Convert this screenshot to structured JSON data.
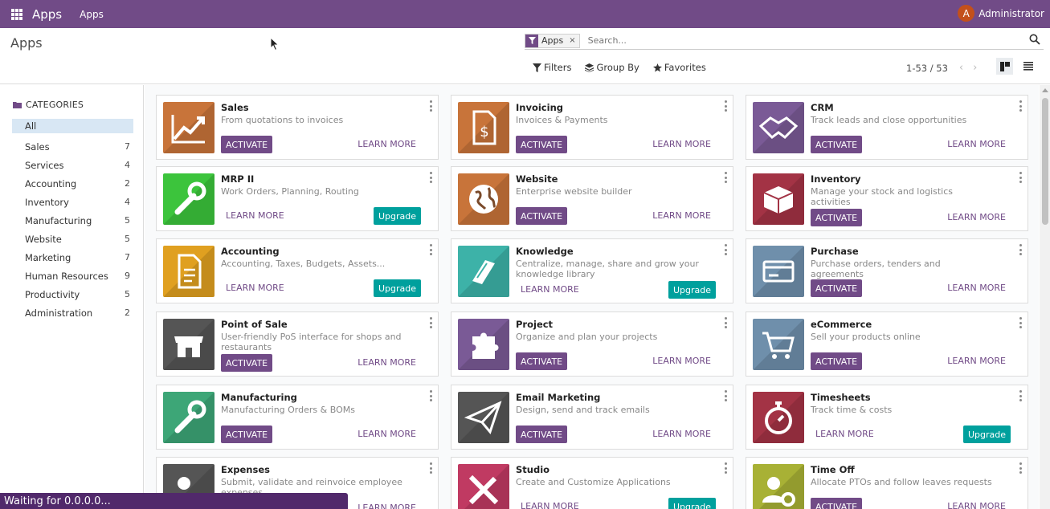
{
  "navbar": {
    "brand": "Apps",
    "menu_item": "Apps",
    "user_initial": "A",
    "user_name": "Administrator",
    "color": "#714b87"
  },
  "control_panel": {
    "title": "Apps",
    "search": {
      "facet_value": "Apps",
      "facet_remove": "×",
      "placeholder": "Search..."
    },
    "filters_label": "Filters",
    "group_by_label": "Group By",
    "favorites_label": "Favorites",
    "pager": "1-53 / 53",
    "pager_prev": "‹",
    "pager_next": "›"
  },
  "sidebar": {
    "header": "CATEGORIES",
    "items": [
      {
        "label": "All",
        "count": ""
      },
      {
        "label": "Sales",
        "count": "7"
      },
      {
        "label": "Services",
        "count": "4"
      },
      {
        "label": "Accounting",
        "count": "2"
      },
      {
        "label": "Inventory",
        "count": "4"
      },
      {
        "label": "Manufacturing",
        "count": "5"
      },
      {
        "label": "Website",
        "count": "5"
      },
      {
        "label": "Marketing",
        "count": "7"
      },
      {
        "label": "Human Resources",
        "count": "9"
      },
      {
        "label": "Productivity",
        "count": "5"
      },
      {
        "label": "Administration",
        "count": "2"
      }
    ]
  },
  "buttons": {
    "activate": "ACTIVATE",
    "learn_more": "LEARN MORE",
    "upgrade": "Upgrade"
  },
  "apps": [
    {
      "name": "Sales",
      "desc": "From quotations to invoices",
      "icon": "chart-up-icon",
      "color": "#c8743a",
      "action": "activate"
    },
    {
      "name": "Invoicing",
      "desc": "Invoices & Payments",
      "icon": "invoice-dollar-icon",
      "color": "#c8743a",
      "action": "activate"
    },
    {
      "name": "CRM",
      "desc": "Track leads and close opportunities",
      "icon": "handshake-icon",
      "color": "#7a5a96",
      "action": "activate"
    },
    {
      "name": "MRP II",
      "desc": "Work Orders, Planning, Routing",
      "icon": "wrench-icon",
      "color": "#3cc43c",
      "action": "upgrade"
    },
    {
      "name": "Website",
      "desc": "Enterprise website builder",
      "icon": "globe-icon",
      "color": "#c8743a",
      "action": "activate"
    },
    {
      "name": "Inventory",
      "desc": "Manage your stock and logistics activities",
      "icon": "box-icon",
      "color": "#a33345",
      "action": "activate"
    },
    {
      "name": "Accounting",
      "desc": "Accounting, Taxes, Budgets, Assets...",
      "icon": "document-icon",
      "color": "#e0a020",
      "action": "upgrade"
    },
    {
      "name": "Knowledge",
      "desc": "Centralize, manage, share and grow your knowledge library",
      "icon": "book-icon",
      "color": "#3db2a8",
      "action": "upgrade"
    },
    {
      "name": "Purchase",
      "desc": "Purchase orders, tenders and agreements",
      "icon": "credit-card-icon",
      "color": "#6f8fab",
      "action": "activate"
    },
    {
      "name": "Point of Sale",
      "desc": "User-friendly PoS interface for shops and restaurants",
      "icon": "store-icon",
      "color": "#555555",
      "action": "activate"
    },
    {
      "name": "Project",
      "desc": "Organize and plan your projects",
      "icon": "puzzle-icon",
      "color": "#7a5a96",
      "action": "activate"
    },
    {
      "name": "eCommerce",
      "desc": "Sell your products online",
      "icon": "cart-icon",
      "color": "#6f8fab",
      "action": "activate"
    },
    {
      "name": "Manufacturing",
      "desc": "Manufacturing Orders & BOMs",
      "icon": "wrench-icon",
      "color": "#3da677",
      "action": "activate"
    },
    {
      "name": "Email Marketing",
      "desc": "Design, send and track emails",
      "icon": "paper-plane-icon",
      "color": "#555555",
      "action": "activate"
    },
    {
      "name": "Timesheets",
      "desc": "Track time & costs",
      "icon": "stopwatch-icon",
      "color": "#a33345",
      "action": "upgrade"
    },
    {
      "name": "Expenses",
      "desc": "Submit, validate and reinvoice employee expenses",
      "icon": "user-dollar-icon",
      "color": "#555555",
      "action": "activate"
    },
    {
      "name": "Studio",
      "desc": "Create and Customize Applications",
      "icon": "tools-icon",
      "color": "#c03a62",
      "action": "upgrade"
    },
    {
      "name": "Time Off",
      "desc": "Allocate PTOs and follow leaves requests",
      "icon": "user-gear-icon",
      "color": "#a8b135",
      "action": "activate"
    }
  ],
  "status": "Waiting for 0.0.0.0..."
}
